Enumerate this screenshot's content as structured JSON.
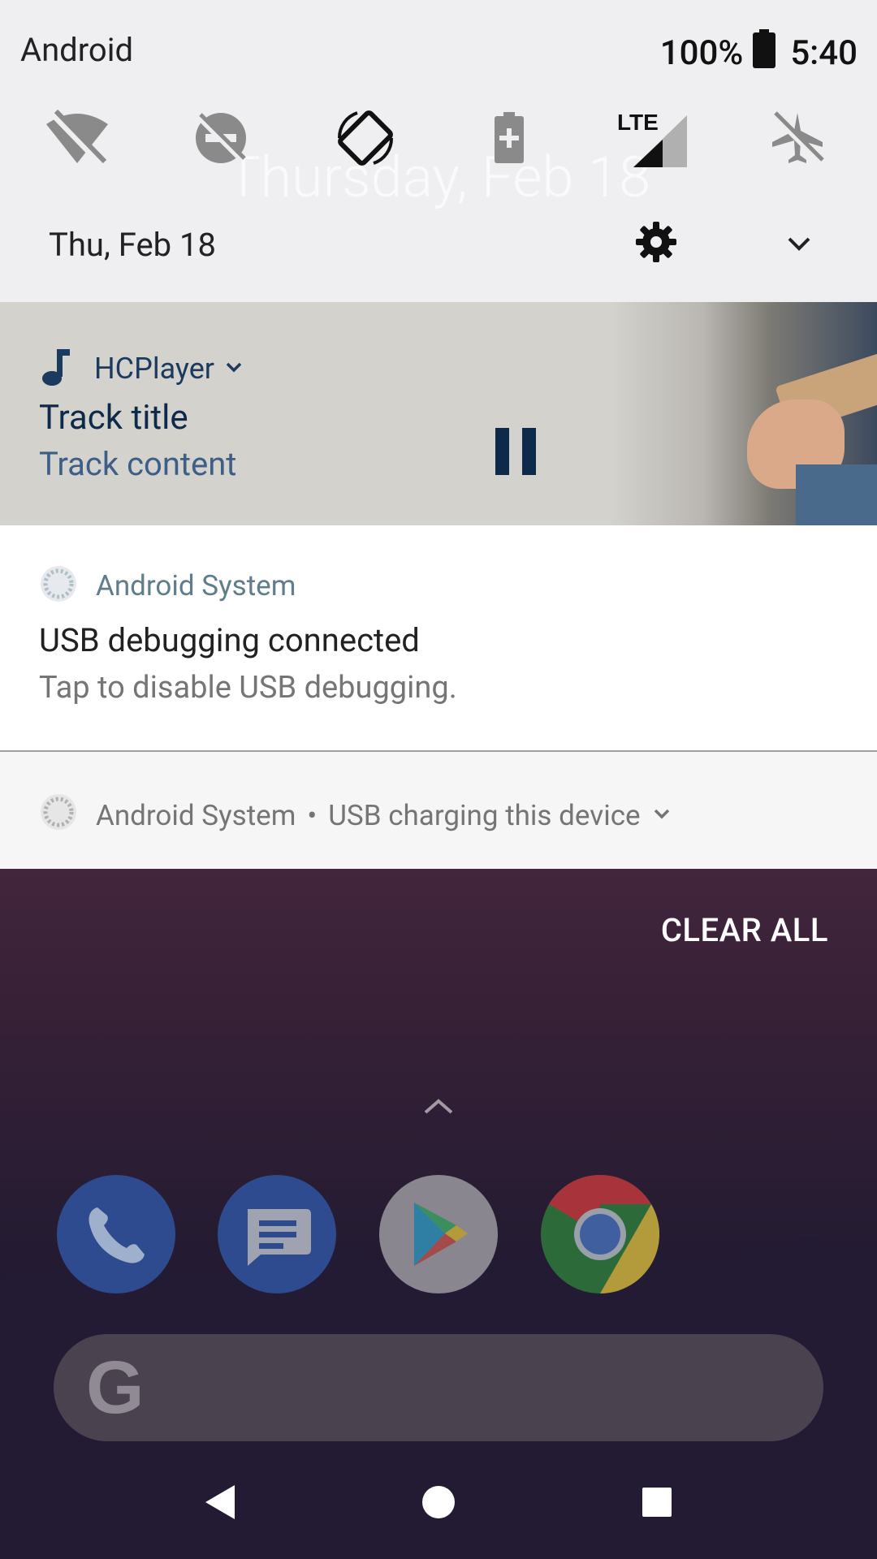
{
  "status_bar": {
    "carrier": "Android",
    "battery": "100%",
    "time": "5:40"
  },
  "quick_settings": {
    "tiles": [
      {
        "name": "wifi-off-icon"
      },
      {
        "name": "do-not-disturb-off-icon"
      },
      {
        "name": "auto-rotate-icon"
      },
      {
        "name": "battery-saver-icon"
      },
      {
        "name": "mobile-data-lte-icon",
        "label": "LTE"
      },
      {
        "name": "airplane-mode-off-icon"
      }
    ],
    "date": "Thu, Feb 18",
    "background_clock": "Thursday, Feb 18"
  },
  "media_notification": {
    "app_name": "HCPlayer",
    "title": "Track title",
    "content": "Track content",
    "action": "pause"
  },
  "usb_debug_notification": {
    "app_name": "Android System",
    "title": "USB debugging connected",
    "text": "Tap to disable USB debugging."
  },
  "usb_charging_notification": {
    "app_name": "Android System",
    "separator": "•",
    "text": "USB charging this device"
  },
  "clear_all_label": "CLEAR ALL",
  "dock": [
    "phone",
    "messages",
    "play-store",
    "chrome"
  ],
  "colors": {
    "qs_background": "#efeff1",
    "media_accent": "#0e2a4a",
    "notification_app_name": "#607d8b",
    "wallpaper_top": "#5a3347"
  }
}
